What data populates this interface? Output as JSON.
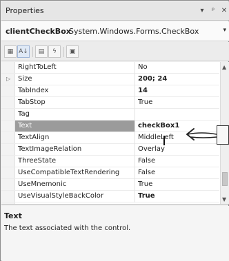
{
  "window": {
    "title": "Properties",
    "icons": {
      "dropdown": "▾",
      "pin": "ᵖ",
      "close": "✕"
    }
  },
  "object_bar": {
    "name": "clientCheckBox",
    "type": "System.Windows.Forms.CheckBox",
    "dropdown_icon": "▾"
  },
  "toolbar": {
    "categorized_icon": "▦",
    "alphabetical_icon": "A↓",
    "properties_icon": "▤",
    "events_icon": "ϟ",
    "pages_icon": "▣"
  },
  "properties": [
    {
      "name": "RightToLeft",
      "value": "No",
      "bold": false,
      "expandable": false,
      "selected": false
    },
    {
      "name": "Size",
      "value": "200; 24",
      "bold": true,
      "expandable": true,
      "selected": false
    },
    {
      "name": "TabIndex",
      "value": "14",
      "bold": true,
      "expandable": false,
      "selected": false
    },
    {
      "name": "TabStop",
      "value": "True",
      "bold": false,
      "expandable": false,
      "selected": false
    },
    {
      "name": "Tag",
      "value": "",
      "bold": false,
      "expandable": false,
      "selected": false
    },
    {
      "name": "Text",
      "value": "checkBox1",
      "bold": true,
      "expandable": false,
      "selected": true
    },
    {
      "name": "TextAlign",
      "value": "MiddleLeft",
      "bold": false,
      "expandable": false,
      "selected": false
    },
    {
      "name": "TextImageRelation",
      "value": "Overlay",
      "bold": false,
      "expandable": false,
      "selected": false
    },
    {
      "name": "ThreeState",
      "value": "False",
      "bold": false,
      "expandable": false,
      "selected": false
    },
    {
      "name": "UseCompatibleTextRendering",
      "value": "False",
      "bold": false,
      "expandable": false,
      "selected": false
    },
    {
      "name": "UseMnemonic",
      "value": "True",
      "bold": false,
      "expandable": false,
      "selected": false
    },
    {
      "name": "UseVisualStyleBackColor",
      "value": "True",
      "bold": true,
      "expandable": false,
      "selected": false
    }
  ],
  "scrollbar": {
    "up_icon": "▲",
    "down_icon": "▼"
  },
  "description": {
    "title": "Text",
    "text": "The text associated with the control."
  },
  "colors": {
    "selected_row_bg": "#9b9b9b",
    "selected_row_fg": "#ffffff"
  }
}
